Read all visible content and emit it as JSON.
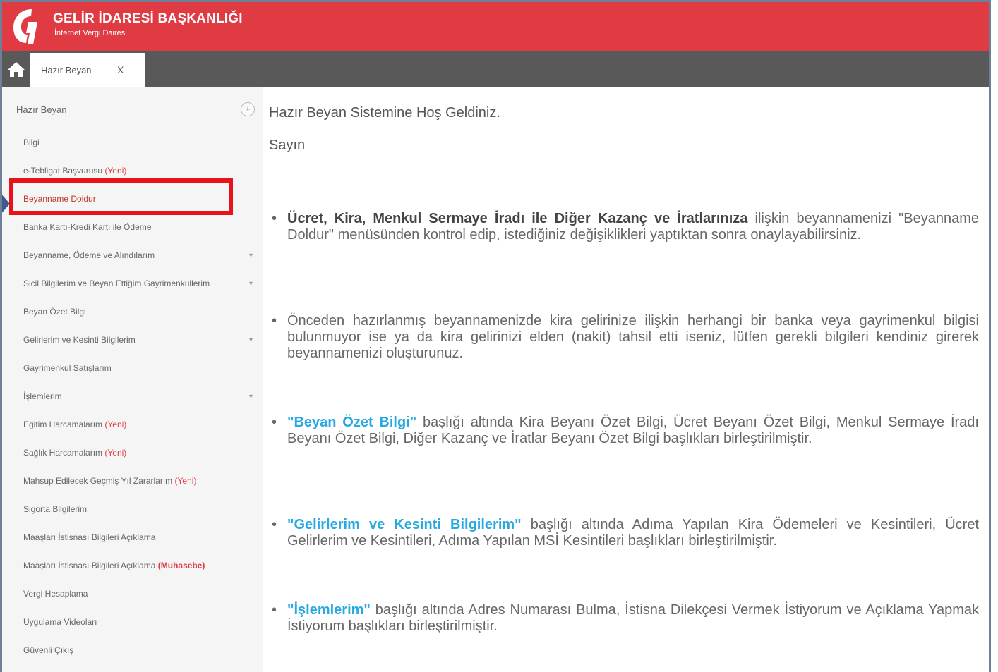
{
  "header": {
    "title": "GELİR İDARESİ BAŞKANLIĞI",
    "subtitle": "İnternet Vergi Dairesi"
  },
  "tabs": [
    {
      "label": "Hazır Beyan",
      "close": "X"
    }
  ],
  "sidebar": {
    "heading": "Hazır Beyan",
    "collapse_icon": "+",
    "items": [
      {
        "label": "Bilgi",
        "tag": ""
      },
      {
        "label": "e-Tebligat Başvurusu",
        "tag": "(Yeni)"
      },
      {
        "label": "Beyanname Doldur",
        "tag": ""
      },
      {
        "label": "Banka Kartı-Kredi Kartı ile Ödeme",
        "tag": ""
      },
      {
        "label": "Beyanname, Ödeme ve Alındılarım",
        "tag": ""
      },
      {
        "label": "Sicil Bilgilerim ve Beyan Ettiğim Gayrimenkullerim",
        "tag": ""
      },
      {
        "label": "Beyan Özet Bilgi",
        "tag": ""
      },
      {
        "label": "Gelirlerim ve Kesinti Bilgilerim",
        "tag": ""
      },
      {
        "label": "Gayrimenkul Satışlarım",
        "tag": ""
      },
      {
        "label": "İşlemlerim",
        "tag": ""
      },
      {
        "label": "Eğitim Harcamalarım",
        "tag": "(Yeni)"
      },
      {
        "label": "Sağlık Harcamalarım",
        "tag": "(Yeni)"
      },
      {
        "label": "Mahsup Edilecek Geçmiş Yıl Zararlarım",
        "tag": "(Yeni)"
      },
      {
        "label": "Sigorta Bilgilerim",
        "tag": ""
      },
      {
        "label": "Maaşları İstisnası Bilgileri Açıklama",
        "tag": ""
      },
      {
        "label": "Maaşları İstisnası Bilgileri Açıklama",
        "tag": "(Muhasebe)"
      },
      {
        "label": "Vergi Hesaplama",
        "tag": ""
      },
      {
        "label": "Uygulama Videoları",
        "tag": ""
      },
      {
        "label": "Güvenli Çıkış",
        "tag": ""
      }
    ]
  },
  "main": {
    "welcome": "Hazır Beyan Sistemine Hoş Geldiniz.",
    "greeting": "Sayın",
    "bullets": [
      {
        "bold": "Ücret, Kira, Menkul Sermaye İradı ile Diğer Kazanç ve İratlarınıza",
        "text": " ilişkin beyannamenizi \"Beyanname Doldur\" menüsünden kontrol edip, istediğiniz değişiklikleri yaptıktan sonra onaylayabilirsiniz."
      },
      {
        "bold": "",
        "text": "Önceden hazırlanmış beyannamenizde kira gelirinize ilişkin herhangi bir banka veya gayrimenkul bilgisi bulunmuyor ise ya da kira gelirinizi elden (nakit) tahsil etti iseniz, lütfen gerekli bilgileri kendiniz girerek beyannamenizi oluşturunuz."
      },
      {
        "link": "\"Beyan Özet Bilgi\"",
        "text": " başlığı altında Kira Beyanı Özet Bilgi, Ücret Beyanı Özet Bilgi, Menkul Sermaye İradı Beyanı Özet Bilgi, Diğer Kazanç ve İratlar Beyanı Özet Bilgi başlıkları birleştirilmiştir."
      },
      {
        "link": "\"Gelirlerim ve Kesinti Bilgilerim\"",
        "text": " başlığı altında Adıma Yapılan Kira Ödemeleri ve Kesintileri, Ücret Gelirlerim ve Kesintileri, Adıma Yapılan MSİ Kesintileri başlıkları birleştirilmiştir."
      },
      {
        "link": "\"İşlemlerim\"",
        "text": " başlığı altında Adres Numarası Bulma, İstisna Dilekçesi Vermek İstiyorum ve Açıklama Yapmak İstiyorum başlıkları birleştirilmiştir."
      }
    ]
  },
  "colors": {
    "brand_red": "#e03a43",
    "tabbar": "#595959",
    "link_blue": "#29a9e1",
    "highlight": "#e8121a"
  }
}
